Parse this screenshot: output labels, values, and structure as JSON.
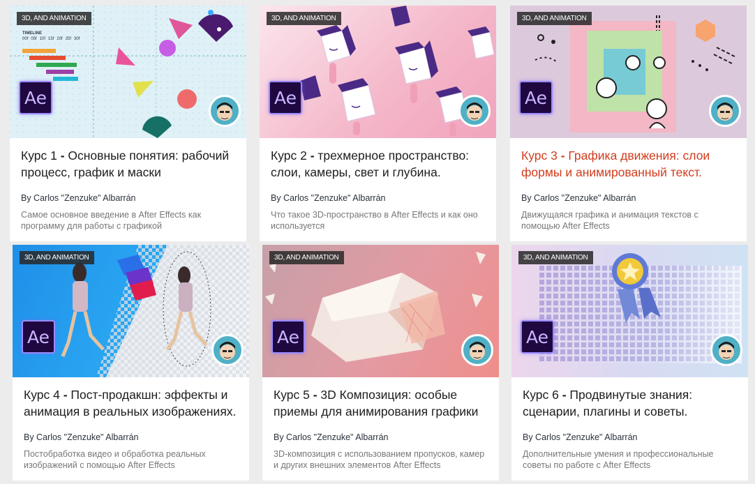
{
  "courses": [
    {
      "badge": "3D, AND ANIMATION",
      "ae_label": "Ae",
      "num": "Курс 1",
      "title": "Основные понятия: рабочий процесс, график и маски",
      "author": "By Carlos \"Zenzuke\" Albarrán",
      "desc": "Самое основное введение в After Effects как программу для работы с графикой",
      "timeline": {
        "label": "TIMELINE",
        "ticks": [
          "00f",
          "05f",
          "10f",
          "15f",
          "20f",
          "25f",
          "30f"
        ]
      }
    },
    {
      "badge": "3D, AND ANIMATION",
      "ae_label": "Ae",
      "num": "Курс 2",
      "title": "трехмерное пространство: слои, камеры, свет и глубина.",
      "author": "By Carlos \"Zenzuke\" Albarrán",
      "desc": "Что такое 3D-пространство в After Effects и как оно используется"
    },
    {
      "badge": "3D, AND ANIMATION",
      "ae_label": "Ae",
      "num": "Курс 3",
      "title": "Графика движения: слои формы и анимированный текст.",
      "author": "By Carlos \"Zenzuke\" Albarrán",
      "desc": "Движущаяся графика и анимация текстов с помощью After Effects"
    },
    {
      "badge": "3D, AND ANIMATION",
      "ae_label": "Ae",
      "num": "Курс 4",
      "title": "Пост-продакшн: эффекты и анимация в реальных изображениях.",
      "author": "By Carlos \"Zenzuke\" Albarrán",
      "desc": "Постобработка видео и обработка реальных изображений с помощью After Effects"
    },
    {
      "badge": "3D, AND ANIMATION",
      "ae_label": "Ae",
      "num": "Курс 5",
      "title": "3D Композиция: особые приемы для анимирования графики",
      "author": "By Carlos \"Zenzuke\" Albarrán",
      "desc": "3D-композиция с использованием пропусков, камер и других внешних элементов After Effects"
    },
    {
      "badge": "3D, AND ANIMATION",
      "ae_label": "Ae",
      "num": "Курс 6",
      "title": "Продвинутые знания: сценарии, плагины и советы.",
      "author": "By Carlos \"Zenzuke\" Albarrán",
      "desc": "Дополнительные умения и профессиональные советы по работе с After Effects"
    }
  ],
  "colors": {
    "accent_title": "#d23c1e",
    "ae_bg": "#1f0840",
    "ae_border": "#9a8bff"
  },
  "active_index": 2
}
